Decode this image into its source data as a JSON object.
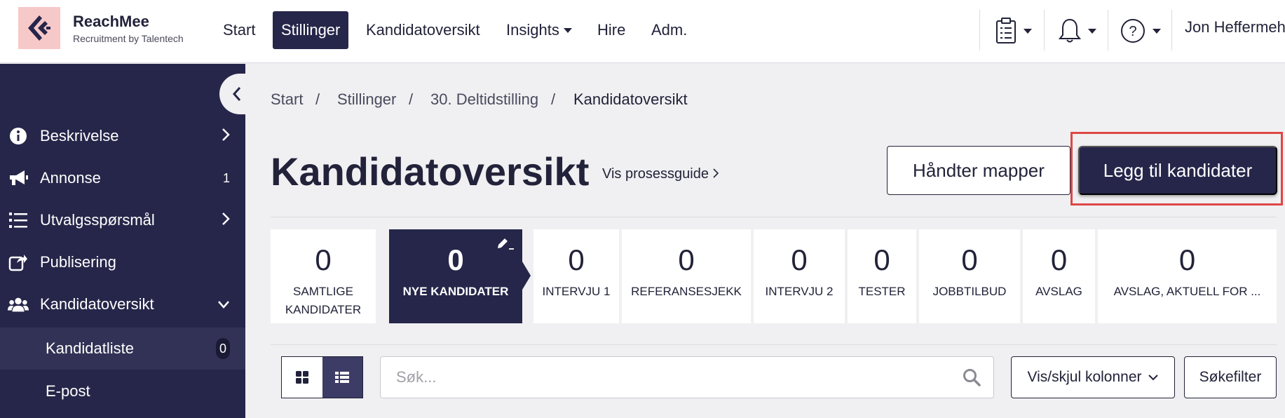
{
  "brand": {
    "title": "ReachMee",
    "subtitle": "Recruitment by Talentech"
  },
  "nav": {
    "items": [
      {
        "label": "Start"
      },
      {
        "label": "Stillinger"
      },
      {
        "label": "Kandidatoversikt"
      },
      {
        "label": "Insights"
      },
      {
        "label": "Hire"
      },
      {
        "label": "Adm."
      }
    ],
    "active": "Stillinger",
    "user": "Jon Heffermehl"
  },
  "sidebar": {
    "items": [
      {
        "label": "Beskrivelse",
        "icon": "info-icon",
        "right": "chevron-right"
      },
      {
        "label": "Annonse",
        "icon": "megaphone-icon",
        "right": "1"
      },
      {
        "label": "Utvalgsspørsmål",
        "icon": "list-icon",
        "right": "chevron-right"
      },
      {
        "label": "Publisering",
        "icon": "share-icon",
        "right": ""
      },
      {
        "label": "Kandidatoversikt",
        "icon": "users-icon",
        "right": "chevron-down"
      },
      {
        "label": "Kandidatliste",
        "badge": "0"
      },
      {
        "label": "E-post"
      }
    ]
  },
  "breadcrumb": [
    "Start",
    "Stillinger",
    "30. Deltidstilling",
    "Kandidatoversikt"
  ],
  "page": {
    "title": "Kandidatoversikt",
    "guide_link": "Vis prosessguide",
    "manage_folders": "Håndter mapper",
    "add_candidates": "Legg til kandidater"
  },
  "stages": [
    {
      "count": "0",
      "label": "SAMTLIGE KANDIDATER"
    },
    {
      "count": "0",
      "label": "NYE KANDIDATER"
    },
    {
      "count": "0",
      "label": "INTERVJU 1"
    },
    {
      "count": "0",
      "label": "REFERANSESJEKK"
    },
    {
      "count": "0",
      "label": "INTERVJU 2"
    },
    {
      "count": "0",
      "label": "TESTER"
    },
    {
      "count": "0",
      "label": "JOBBTILBUD"
    },
    {
      "count": "0",
      "label": "AVSLAG"
    },
    {
      "count": "0",
      "label": "AVSLAG, AKTUELL FOR ..."
    }
  ],
  "toolbar": {
    "search_placeholder": "Søk...",
    "columns_button": "Vis/skjul kolonner",
    "filter_button": "Søkefilter"
  },
  "colors": {
    "navy": "#26264a",
    "highlight": "#e04646",
    "logo_bg": "#f7c8c8"
  }
}
